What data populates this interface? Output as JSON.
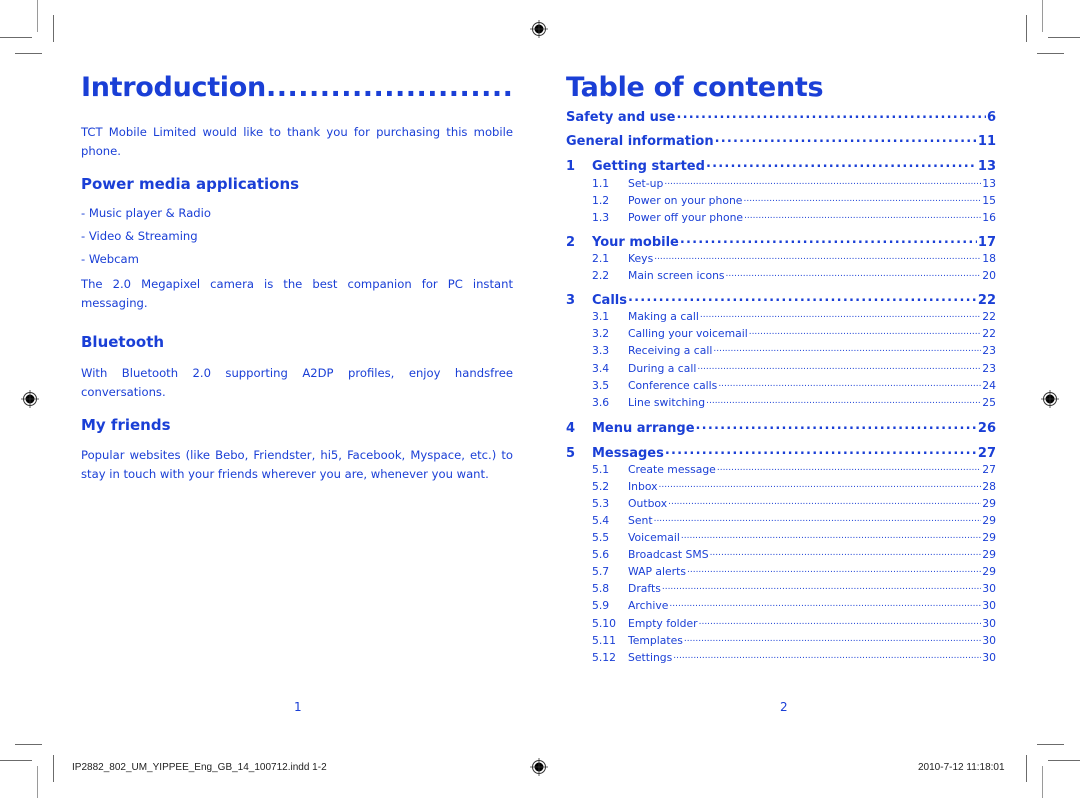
{
  "left_page": {
    "title": "Introduction",
    "title_leader": "................................",
    "intro_text": "TCT Mobile Limited would like to thank you for purchasing this mobile phone.",
    "sections": [
      {
        "heading": "Power media applications",
        "bullets": [
          "- Music player & Radio",
          "- Video & Streaming",
          "- Webcam"
        ],
        "text": "The 2.0 Megapixel camera is the best companion for PC instant messaging."
      },
      {
        "heading": "Bluetooth",
        "text": "With Bluetooth 2.0 supporting A2DP profiles, enjoy handsfree conversations."
      },
      {
        "heading": "My friends",
        "text": "Popular websites (like Bebo, Friendster, hi5, Facebook, Myspace, etc.) to stay in touch with your friends wherever you are, whenever you want."
      }
    ],
    "page_number": "1"
  },
  "right_page": {
    "title": "Table of contents",
    "toc": [
      {
        "num": "",
        "label": "Safety and use",
        "page": "6",
        "level": "main"
      },
      {
        "num": "",
        "label": "General information",
        "page": "11",
        "level": "main"
      },
      {
        "num": "1",
        "label": "Getting started",
        "page": "13",
        "level": "main"
      },
      {
        "num": "1.1",
        "label": "Set-up",
        "page": "13",
        "level": "sub"
      },
      {
        "num": "1.2",
        "label": "Power on your phone",
        "page": "15",
        "level": "sub"
      },
      {
        "num": "1.3",
        "label": "Power off your phone",
        "page": "16",
        "level": "sub"
      },
      {
        "num": "2",
        "label": "Your mobile",
        "page": "17",
        "level": "main"
      },
      {
        "num": "2.1",
        "label": "Keys",
        "page": "18",
        "level": "sub"
      },
      {
        "num": "2.2",
        "label": "Main screen icons",
        "page": "20",
        "level": "sub"
      },
      {
        "num": "3",
        "label": "Calls",
        "page": "22",
        "level": "main"
      },
      {
        "num": "3.1",
        "label": "Making a call",
        "page": "22",
        "level": "sub"
      },
      {
        "num": "3.2",
        "label": "Calling your voicemail",
        "page": "22",
        "level": "sub"
      },
      {
        "num": "3.3",
        "label": "Receiving a call",
        "page": "23",
        "level": "sub"
      },
      {
        "num": "3.4",
        "label": "During a call",
        "page": "23",
        "level": "sub"
      },
      {
        "num": "3.5",
        "label": "Conference calls",
        "page": "24",
        "level": "sub"
      },
      {
        "num": "3.6",
        "label": "Line switching",
        "page": "25",
        "level": "sub"
      },
      {
        "num": "4",
        "label": "Menu arrange",
        "page": "26",
        "level": "main"
      },
      {
        "num": "5",
        "label": "Messages",
        "page": "27",
        "level": "main"
      },
      {
        "num": "5.1",
        "label": "Create message",
        "page": "27",
        "level": "sub"
      },
      {
        "num": "5.2",
        "label": "Inbox",
        "page": "28",
        "level": "sub"
      },
      {
        "num": "5.3",
        "label": "Outbox",
        "page": "29",
        "level": "sub"
      },
      {
        "num": "5.4",
        "label": "Sent",
        "page": "29",
        "level": "sub"
      },
      {
        "num": "5.5",
        "label": "Voicemail",
        "page": "29",
        "level": "sub"
      },
      {
        "num": "5.6",
        "label": "Broadcast SMS",
        "page": "29",
        "level": "sub"
      },
      {
        "num": "5.7",
        "label": "WAP alerts",
        "page": "29",
        "level": "sub"
      },
      {
        "num": "5.8",
        "label": "Drafts",
        "page": "30",
        "level": "sub"
      },
      {
        "num": "5.9",
        "label": "Archive",
        "page": "30",
        "level": "sub"
      },
      {
        "num": "5.10",
        "label": "Empty folder",
        "page": "30",
        "level": "sub"
      },
      {
        "num": "5.11",
        "label": "Templates",
        "page": "30",
        "level": "sub"
      },
      {
        "num": "5.12",
        "label": "Settings",
        "page": "30",
        "level": "sub"
      }
    ],
    "page_number": "2"
  },
  "slug": {
    "filename": "IP2882_802_UM_YIPPEE_Eng_GB_14_100712.indd   1-2",
    "timestamp": "2010-7-12   11:18:01"
  },
  "colors": {
    "text_blue": "#1a3fd6",
    "crop_mark": "#6b6b6b"
  }
}
